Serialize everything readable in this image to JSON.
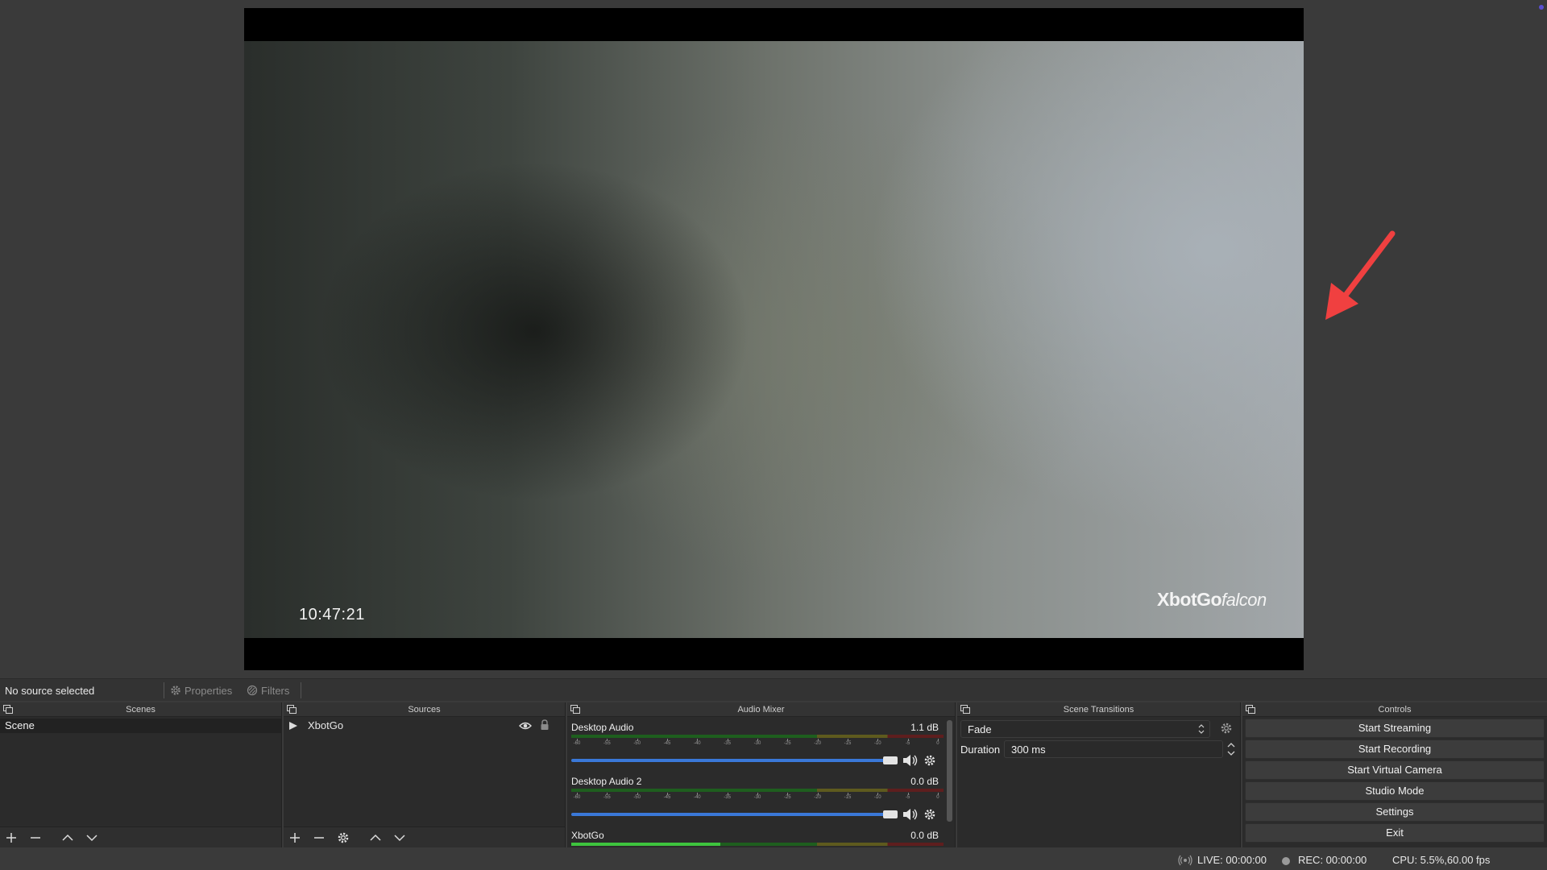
{
  "preview": {
    "video_time": "10:47:21",
    "watermark_main": "XbotGo",
    "watermark_script": "falcon",
    "annotation_color": "#f04040"
  },
  "source_bar": {
    "status": "No source selected",
    "properties_label": "Properties",
    "filters_label": "Filters"
  },
  "docks": {
    "scenes": {
      "title": "Scenes",
      "items": [
        "Scene"
      ]
    },
    "sources": {
      "title": "Sources",
      "items": [
        "XbotGo"
      ]
    },
    "mixer": {
      "title": "Audio Mixer",
      "scale_ticks": [
        "-60",
        "-55",
        "-50",
        "-45",
        "-40",
        "-35",
        "-30",
        "-25",
        "-20",
        "-15",
        "-10",
        "-5",
        "0"
      ],
      "channels": [
        {
          "name": "Desktop Audio",
          "db": "1.1 dB"
        },
        {
          "name": "Desktop Audio 2",
          "db": "0.0 dB"
        },
        {
          "name": "XbotGo",
          "db": "0.0 dB"
        }
      ]
    },
    "transitions": {
      "title": "Scene Transitions",
      "selected": "Fade",
      "duration_label": "Duration",
      "duration_value": "300 ms"
    },
    "controls": {
      "title": "Controls",
      "buttons": [
        "Start Streaming",
        "Start Recording",
        "Start Virtual Camera",
        "Studio Mode",
        "Settings",
        "Exit"
      ]
    }
  },
  "status": {
    "live": "LIVE: 00:00:00",
    "rec": "REC: 00:00:00",
    "cpu": "CPU: 5.5%,60.00 fps"
  }
}
